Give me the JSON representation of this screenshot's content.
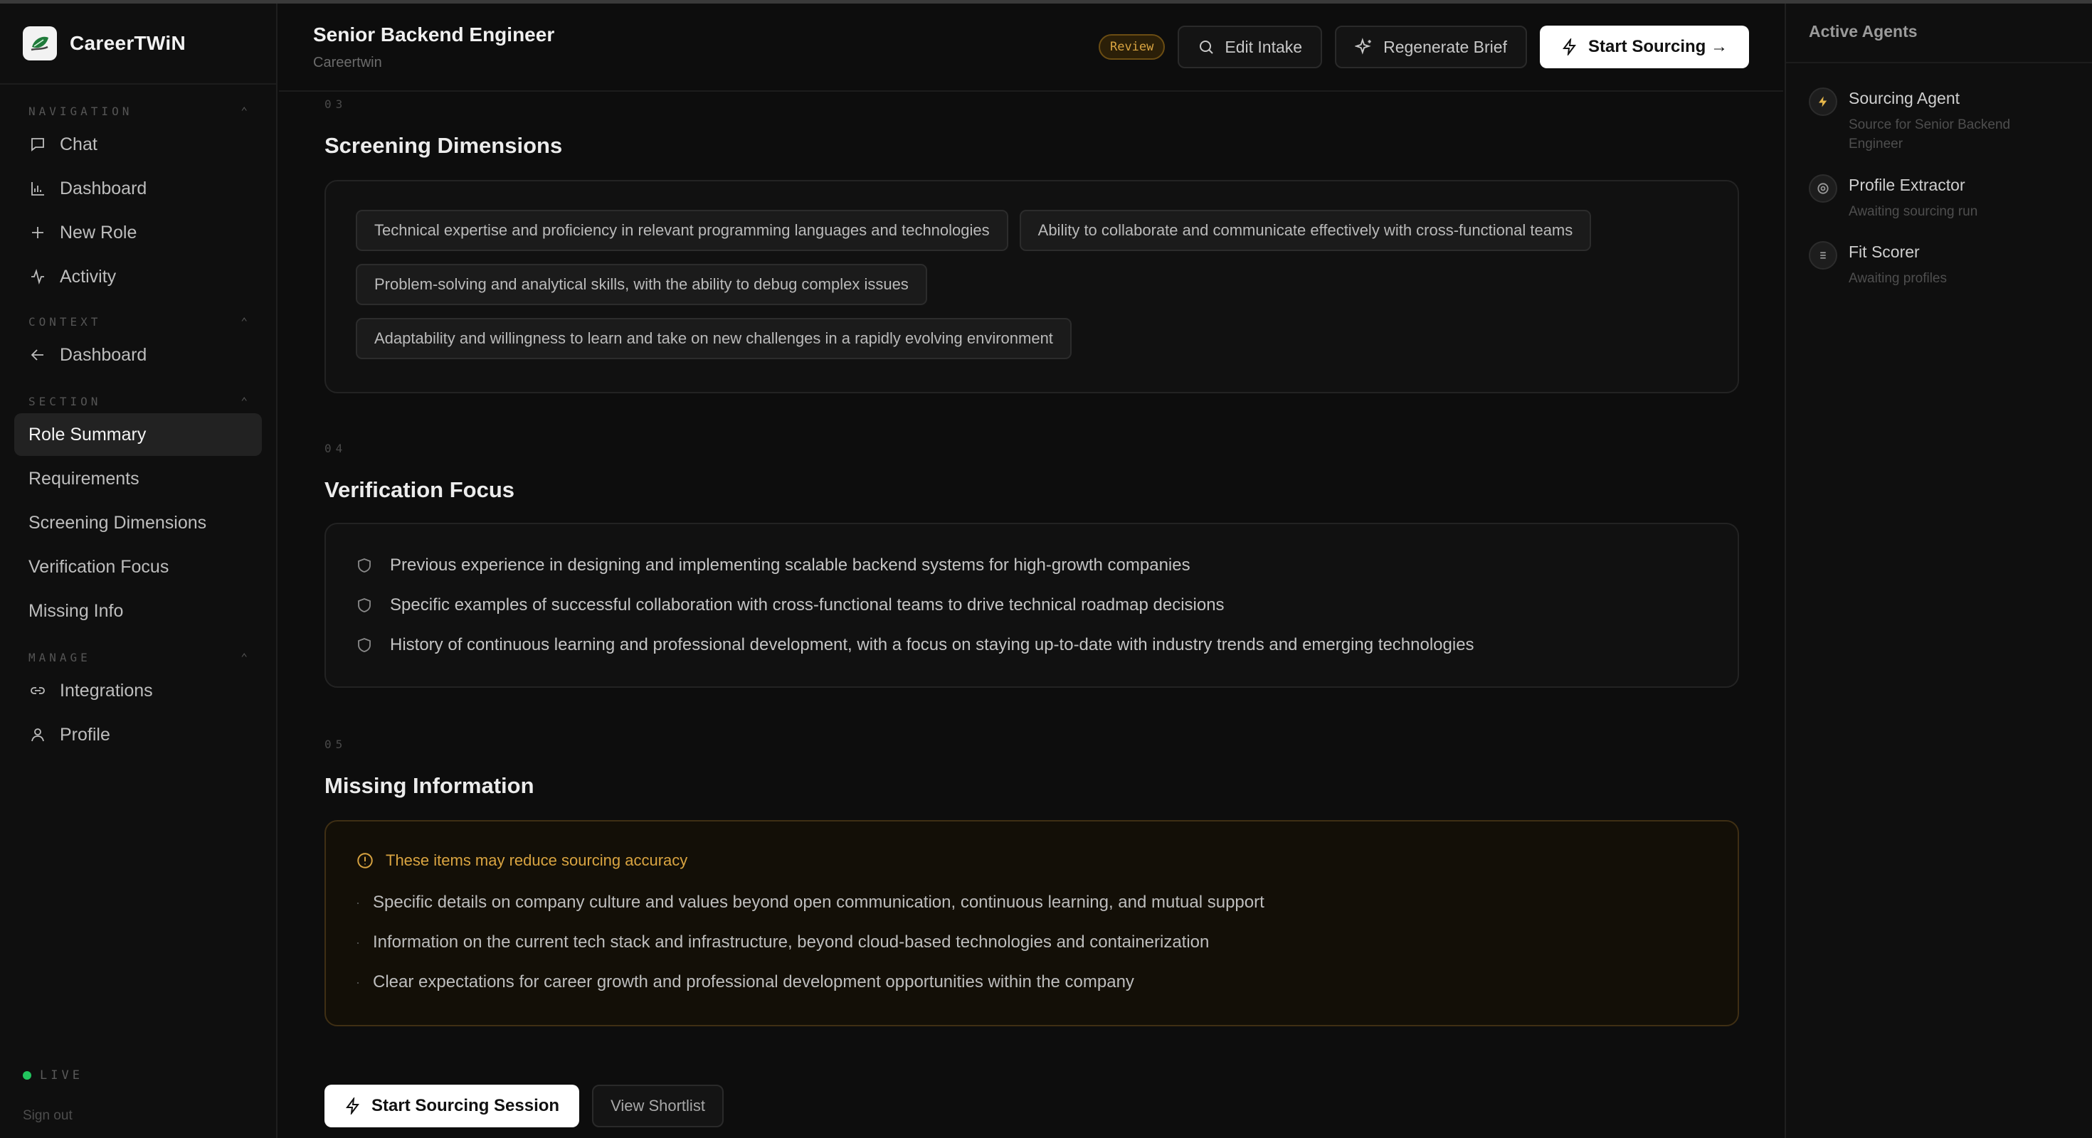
{
  "brand": {
    "name": "CareerTWiN",
    "logo_icon": "leaf-logo-icon"
  },
  "sidebar": {
    "sections": {
      "navigation": "NAVIGATION",
      "context": "CONTEXT",
      "section": "SECTION",
      "manage": "MANAGE"
    },
    "navigation": [
      {
        "label": "Chat",
        "icon": "chat-icon"
      },
      {
        "label": "Dashboard",
        "icon": "bar-chart-icon"
      },
      {
        "label": "New Role",
        "icon": "plus-icon"
      },
      {
        "label": "Activity",
        "icon": "activity-icon"
      }
    ],
    "context": [
      {
        "label": "Dashboard",
        "icon": "arrow-left-icon"
      }
    ],
    "section_items": [
      {
        "label": "Role Summary",
        "active": true
      },
      {
        "label": "Requirements"
      },
      {
        "label": "Screening Dimensions"
      },
      {
        "label": "Verification Focus"
      },
      {
        "label": "Missing Info"
      }
    ],
    "manage": [
      {
        "label": "Integrations",
        "icon": "link-icon"
      },
      {
        "label": "Profile",
        "icon": "user-icon"
      }
    ],
    "live_label": "LIVE",
    "signout_label": "Sign out"
  },
  "header": {
    "title": "Senior Backend Engineer",
    "subtitle": "Careertwin",
    "badge": "Review",
    "edit_intake": "Edit Intake",
    "regenerate_brief": "Regenerate Brief",
    "start_sourcing": "Start Sourcing →"
  },
  "screening": {
    "number": "03",
    "title": "Screening Dimensions",
    "chips": [
      "Technical expertise and proficiency in relevant programming languages and technologies",
      "Ability to collaborate and communicate effectively with cross-functional teams",
      "Problem-solving and analytical skills, with the ability to debug complex issues",
      "Adaptability and willingness to learn and take on new challenges in a rapidly evolving environment"
    ]
  },
  "verification": {
    "number": "04",
    "title": "Verification Focus",
    "items": [
      "Previous experience in designing and implementing scalable backend systems for high-growth companies",
      "Specific examples of successful collaboration with cross-functional teams to drive technical roadmap decisions",
      "History of continuous learning and professional development, with a focus on staying up-to-date with industry trends and emerging technologies"
    ]
  },
  "missing": {
    "number": "05",
    "title": "Missing Information",
    "warning": "These items may reduce sourcing accuracy",
    "items": [
      "Specific details on company culture and values beyond open communication, continuous learning, and mutual support",
      "Information on the current tech stack and infrastructure, beyond cloud-based technologies and containerization",
      "Clear expectations for career growth and professional development opportunities within the company"
    ]
  },
  "actions": {
    "start_session": "Start Sourcing Session",
    "view_shortlist": "View Shortlist"
  },
  "agents": {
    "title": "Active Agents",
    "list": [
      {
        "name": "Sourcing Agent",
        "desc": "Source for Senior Backend Engineer",
        "icon": "lightning-icon"
      },
      {
        "name": "Profile Extractor",
        "desc": "Awaiting sourcing run",
        "icon": "target-icon"
      },
      {
        "name": "Fit Scorer",
        "desc": "Awaiting profiles",
        "icon": "list-icon"
      }
    ]
  },
  "colors": {
    "accent_amber": "#d9a441",
    "live_green": "#22c55e",
    "background": "#0d0d0d"
  }
}
